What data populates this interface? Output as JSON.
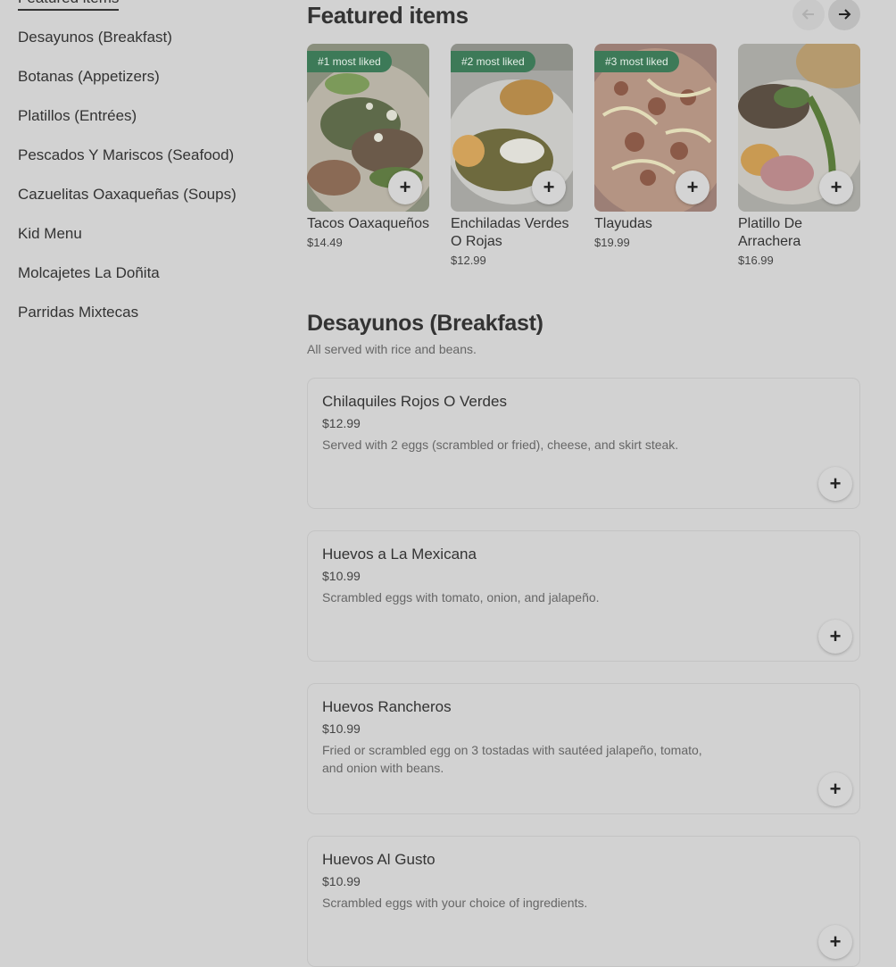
{
  "sidebar": {
    "items": [
      {
        "label": "Featured items",
        "active": true
      },
      {
        "label": "Desayunos (Breakfast)"
      },
      {
        "label": "Botanas (Appetizers)"
      },
      {
        "label": "Platillos (Entrées)"
      },
      {
        "label": "Pescados Y Mariscos (Seafood)"
      },
      {
        "label": "Cazuelitas Oaxaqueñas (Soups)"
      },
      {
        "label": "Kid Menu"
      },
      {
        "label": "Molcajetes La Doñita"
      },
      {
        "label": "Parridas Mixtecas"
      }
    ]
  },
  "featured": {
    "title": "Featured items",
    "prev_icon": "arrow-left-icon",
    "next_icon": "arrow-right-icon",
    "cards": [
      {
        "badge": "#1 most liked",
        "name": "Tacos Oaxaqueños",
        "price": "$14.49"
      },
      {
        "badge": "#2 most liked",
        "name": "Enchiladas Verdes O Rojas",
        "price": "$12.99"
      },
      {
        "badge": "#3 most liked",
        "name": "Tlayudas",
        "price": "$19.99"
      },
      {
        "badge": "",
        "name": "Platillo De Arrachera",
        "price": "$16.99"
      }
    ]
  },
  "section": {
    "title": "Desayunos (Breakfast)",
    "subtitle": "All served with rice and beans.",
    "items": [
      {
        "name": "Chilaquiles Rojos O Verdes",
        "price": "$12.99",
        "desc": "Served with 2 eggs (scrambled or fried), cheese, and skirt steak."
      },
      {
        "name": "Huevos a La Mexicana",
        "price": "$10.99",
        "desc": "Scrambled eggs with tomato, onion, and jalapeño."
      },
      {
        "name": "Huevos Rancheros",
        "price": "$10.99",
        "desc": "Fried or scrambled egg on 3 tostadas with sautéed jalapeño, tomato, and onion with beans."
      },
      {
        "name": "Huevos Al Gusto",
        "price": "$10.99",
        "desc": "Scrambled eggs with your choice of ingredients."
      }
    ]
  },
  "colors": {
    "badge": "#3d7a58",
    "overlay_bg": "#d2d2d2"
  },
  "plus_symbol": "+"
}
